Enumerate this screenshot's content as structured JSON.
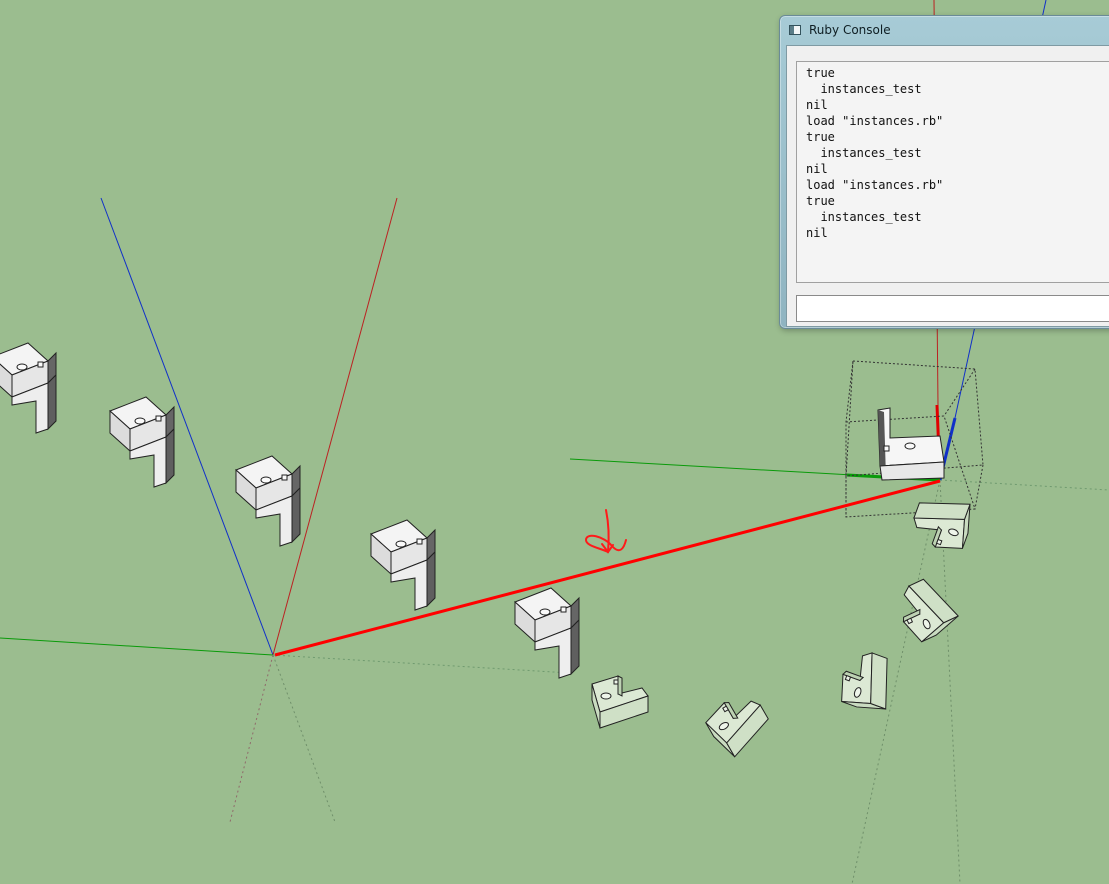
{
  "scene": {
    "background_color": "#9bbd8f",
    "axis_colors": {
      "x": "#e00000",
      "y": "#0a9a0a",
      "z": "#1030c8"
    },
    "component_color_unselected": "#f2f2f2",
    "component_color_rotated": "#d8e8cf",
    "component_shadow_color": "#777777",
    "annotation": "hand-drawn rotation arrow"
  },
  "console": {
    "title": "Ruby Console",
    "output_lines": [
      "true",
      "  instances_test",
      "nil",
      "load \"instances.rb\"",
      "true",
      "  instances_test",
      "nil",
      "load \"instances.rb\"",
      "true",
      "  instances_test",
      "nil"
    ],
    "input_value": ""
  }
}
